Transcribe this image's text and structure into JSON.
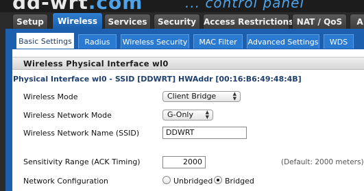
{
  "header": {
    "logo_text": "dd-wrt",
    "logo_suffix": ".com",
    "tagline": "... control panel"
  },
  "main_tabs": [
    {
      "label": "Setup"
    },
    {
      "label": "Wireless",
      "active": true
    },
    {
      "label": "Services"
    },
    {
      "label": "Security"
    },
    {
      "label": "Access Restrictions"
    },
    {
      "label": "NAT / QoS"
    },
    {
      "label": "A"
    }
  ],
  "sub_tabs": [
    {
      "label": "Basic Settings",
      "active": true
    },
    {
      "label": "Radius"
    },
    {
      "label": "Wireless Security"
    },
    {
      "label": "MAC Filter"
    },
    {
      "label": "Advanced Settings"
    },
    {
      "label": "WDS"
    }
  ],
  "section": {
    "title": "Wireless Physical Interface wl0",
    "interface_title": "Physical Interface wl0 - SSID [DDWRT] HWAddr [00:16:B6:49:48:4B]"
  },
  "fields": {
    "wireless_mode": {
      "label": "Wireless Mode",
      "value": "Client Bridge"
    },
    "network_mode": {
      "label": "Wireless Network Mode",
      "value": "G-Only"
    },
    "ssid": {
      "label": "Wireless Network Name (SSID)",
      "value": "DDWRT"
    },
    "sensitivity": {
      "label": "Sensitivity Range (ACK Timing)",
      "value": "2000",
      "hint": "(Default: 2000 meters)"
    },
    "network_config": {
      "label": "Network Configuration",
      "options": [
        {
          "label": "Unbridged",
          "checked": false
        },
        {
          "label": "Bridged",
          "checked": true
        }
      ]
    }
  },
  "colors": {
    "accent_blue": "#1b5fae",
    "subtab_blue": "#2a7ad1",
    "logo_blue": "#4fa3e8",
    "title_blue": "#1f3f6f"
  }
}
